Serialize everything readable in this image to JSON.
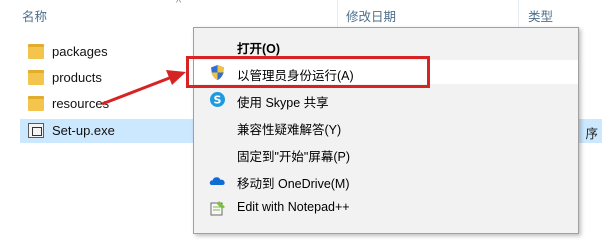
{
  "columns": {
    "name": "名称",
    "modified": "修改日期",
    "type": "类型"
  },
  "sort_indicator": "^",
  "files": [
    {
      "name": "packages",
      "icon": "folder-icon"
    },
    {
      "name": "products",
      "icon": "folder-icon"
    },
    {
      "name": "resources",
      "icon": "folder-icon"
    },
    {
      "name": "Set-up.exe",
      "icon": "exe-icon",
      "type_tail": "序"
    }
  ],
  "context_menu": {
    "items": [
      {
        "label": "打开(O)",
        "icon": "none",
        "bold": true
      },
      {
        "label": "以管理员身份运行(A)",
        "icon": "uac-shield-icon"
      },
      {
        "label": "使用 Skype 共享",
        "icon": "skype-icon"
      },
      {
        "label": "兼容性疑难解答(Y)",
        "icon": "none"
      },
      {
        "label": "固定到\"开始\"屏幕(P)",
        "icon": "none"
      },
      {
        "label": "移动到 OneDrive(M)",
        "icon": "onedrive-icon"
      },
      {
        "label": "Edit with Notepad++",
        "icon": "notepadpp-icon"
      }
    ]
  },
  "colors": {
    "selection": "#cce8ff",
    "annotation_red": "#d62424",
    "menu_bg": "#f2f2f2",
    "header_text": "#4d6f8c"
  }
}
